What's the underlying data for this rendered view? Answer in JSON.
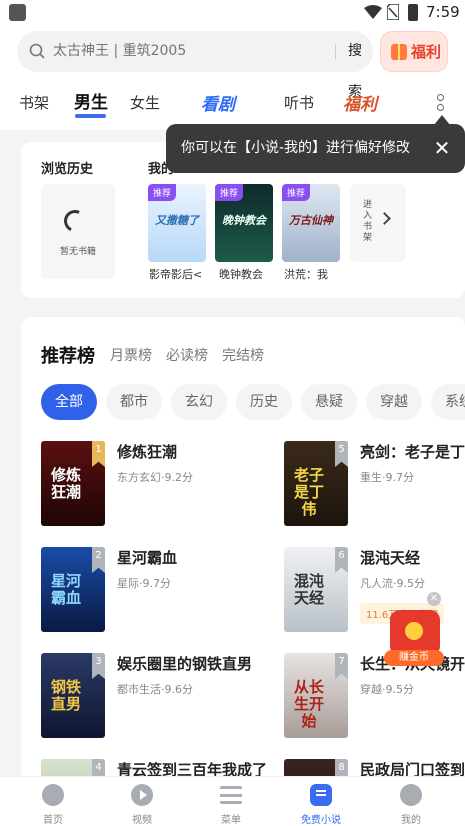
{
  "status_bar": {
    "time": "7:59"
  },
  "search": {
    "placeholder": "太古神王 | 重筑2005",
    "button": "搜索"
  },
  "welfare_button": {
    "label": "福利"
  },
  "top_tabs": [
    {
      "label": "书架"
    },
    {
      "label": "男生",
      "active": true
    },
    {
      "label": "女生"
    },
    {
      "label": "看剧"
    },
    {
      "label": "听书"
    },
    {
      "label": "福利"
    }
  ],
  "tooltip": {
    "text": "你可以在【小说-我的】进行偏好修改"
  },
  "history": {
    "title": "浏览历史",
    "empty_text": "暂无书籍",
    "shelf_title": "我的",
    "shelf_books": [
      {
        "tag": "推荐",
        "cover_text": "又撒糖了",
        "title": "影帝影后<"
      },
      {
        "tag": "推荐",
        "cover_text": "晚钟教会",
        "title": "晚钟教会"
      },
      {
        "tag": "推荐",
        "cover_text": "万古仙神",
        "title": "洪荒：我"
      }
    ],
    "enter_shelf": "进入书架"
  },
  "ranking": {
    "tabs": [
      {
        "label": "推荐榜",
        "active": true
      },
      {
        "label": "月票榜"
      },
      {
        "label": "必读榜"
      },
      {
        "label": "完结榜"
      }
    ],
    "chips": [
      {
        "label": "全部",
        "active": true
      },
      {
        "label": "都市"
      },
      {
        "label": "玄幻"
      },
      {
        "label": "历史"
      },
      {
        "label": "悬疑"
      },
      {
        "label": "穿越"
      },
      {
        "label": "系统"
      }
    ],
    "books": [
      {
        "rank": "1",
        "title": "修炼狂潮",
        "meta": "东方玄幻·9.2分",
        "cover_text": "修炼狂潮",
        "cover_color": "#3a0d0d"
      },
      {
        "rank": "5",
        "title": "亮剑：老子是丁伟",
        "meta": "重生·9.7分",
        "cover_text": "老子是丁伟",
        "cover_color": "#2a2218"
      },
      {
        "rank": "2",
        "title": "星河霸血",
        "meta": "星际·9.7分",
        "cover_text": "星河霸血",
        "cover_color": "#10306e"
      },
      {
        "rank": "6",
        "title": "混沌天经",
        "meta": "凡人流·9.5分",
        "badge": "11.6万人加书架",
        "cover_text": "混沌天经",
        "cover_color": "#d9dde2"
      },
      {
        "rank": "3",
        "title": "娱乐圈里的钢铁直男",
        "meta": "都市生活·9.6分",
        "cover_text": "钢铁直男",
        "cover_color": "#1c2a4a"
      },
      {
        "rank": "7",
        "title": "长生：从天镜开始",
        "meta": "穿越·9.5分",
        "cover_text": "从长生开始",
        "cover_color": "#d7d2cf"
      },
      {
        "rank": "4",
        "title": "青云签到三百年我成了",
        "meta": "",
        "cover_text": "",
        "cover_color": "#cfd9c8"
      },
      {
        "rank": "8",
        "title": "民政局门口签到，",
        "meta": "",
        "cover_text": "",
        "cover_color": "#2b1e1e"
      }
    ]
  },
  "gold_float": {
    "label": "赚金币"
  },
  "bottom_nav": [
    {
      "label": "首页",
      "icon": "home-icon"
    },
    {
      "label": "视频",
      "icon": "video-icon"
    },
    {
      "label": "菜单",
      "icon": "menu-icon"
    },
    {
      "label": "免费小说",
      "icon": "novel-icon",
      "active": true
    },
    {
      "label": "我的",
      "icon": "profile-icon"
    }
  ],
  "colors": {
    "accent": "#2f62e8",
    "welfare": "#e8402a",
    "rank_gold": "#e6b85a"
  }
}
